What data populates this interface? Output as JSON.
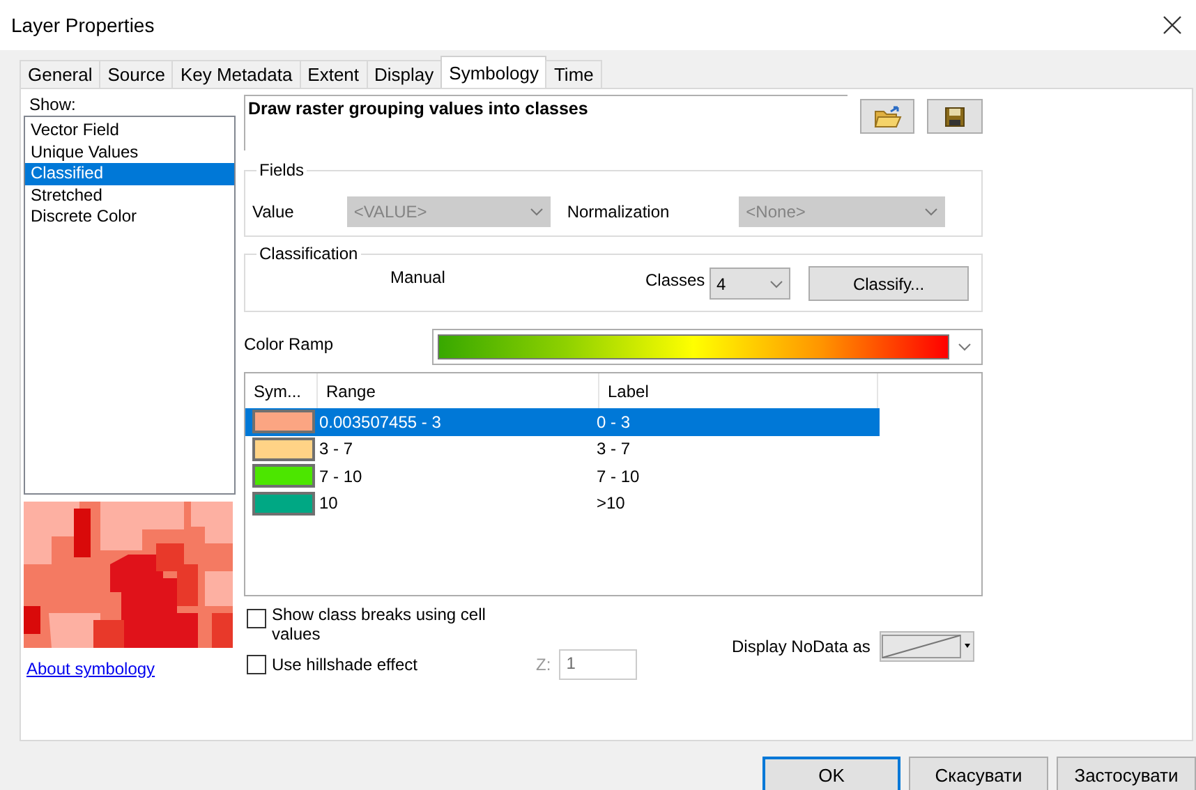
{
  "window": {
    "title": "Layer Properties"
  },
  "tabs": [
    {
      "label": "General",
      "selected": false
    },
    {
      "label": "Source",
      "selected": false
    },
    {
      "label": "Key Metadata",
      "selected": false
    },
    {
      "label": "Extent",
      "selected": false
    },
    {
      "label": "Display",
      "selected": false
    },
    {
      "label": "Symbology",
      "selected": true
    },
    {
      "label": "Time",
      "selected": false
    }
  ],
  "show": {
    "label": "Show:",
    "items": [
      {
        "label": "Vector Field",
        "selected": false
      },
      {
        "label": "Unique Values",
        "selected": false
      },
      {
        "label": "Classified",
        "selected": true
      },
      {
        "label": "Stretched",
        "selected": false
      },
      {
        "label": "Discrete Color",
        "selected": false
      }
    ]
  },
  "about_link": "About symbology",
  "description": "Draw raster grouping values into classes",
  "fields": {
    "title": "Fields",
    "value_label": "Value",
    "value_field": {
      "value": "<VALUE>",
      "disabled": true
    },
    "normalization_label": "Normalization",
    "normalization_field": {
      "value": "<None>",
      "disabled": true
    }
  },
  "classification": {
    "title": "Classification",
    "method": "Manual",
    "classes_label": "Classes",
    "classes_value": "4",
    "classify_button": "Classify..."
  },
  "color_ramp_label": "Color Ramp",
  "table": {
    "columns": [
      "Sym...",
      "Range",
      "Label"
    ],
    "rows": [
      {
        "color": "#fba582",
        "range": "0.003507455 - 3",
        "label": "0 - 3",
        "selected": true
      },
      {
        "color": "#ffd386",
        "range": "3 - 7",
        "label": "3 - 7",
        "selected": false
      },
      {
        "color": "#4ce600",
        "range": "7 - 10",
        "label": "7 - 10",
        "selected": false
      },
      {
        "color": "#00a884",
        "range": "10",
        "label": ">10",
        "selected": false
      }
    ]
  },
  "options": [
    {
      "label": "Show class breaks using cell values",
      "checked": false
    },
    {
      "label": "Use hillshade effect",
      "checked": false
    }
  ],
  "z_label": "Z:",
  "z_field": {
    "value": "1",
    "disabled": true
  },
  "nodata_label": "Display NoData as",
  "buttons": [
    {
      "label": "OK",
      "default": true
    },
    {
      "label": "Скасувати",
      "default": false
    },
    {
      "label": "Застосувати",
      "default": false
    }
  ]
}
